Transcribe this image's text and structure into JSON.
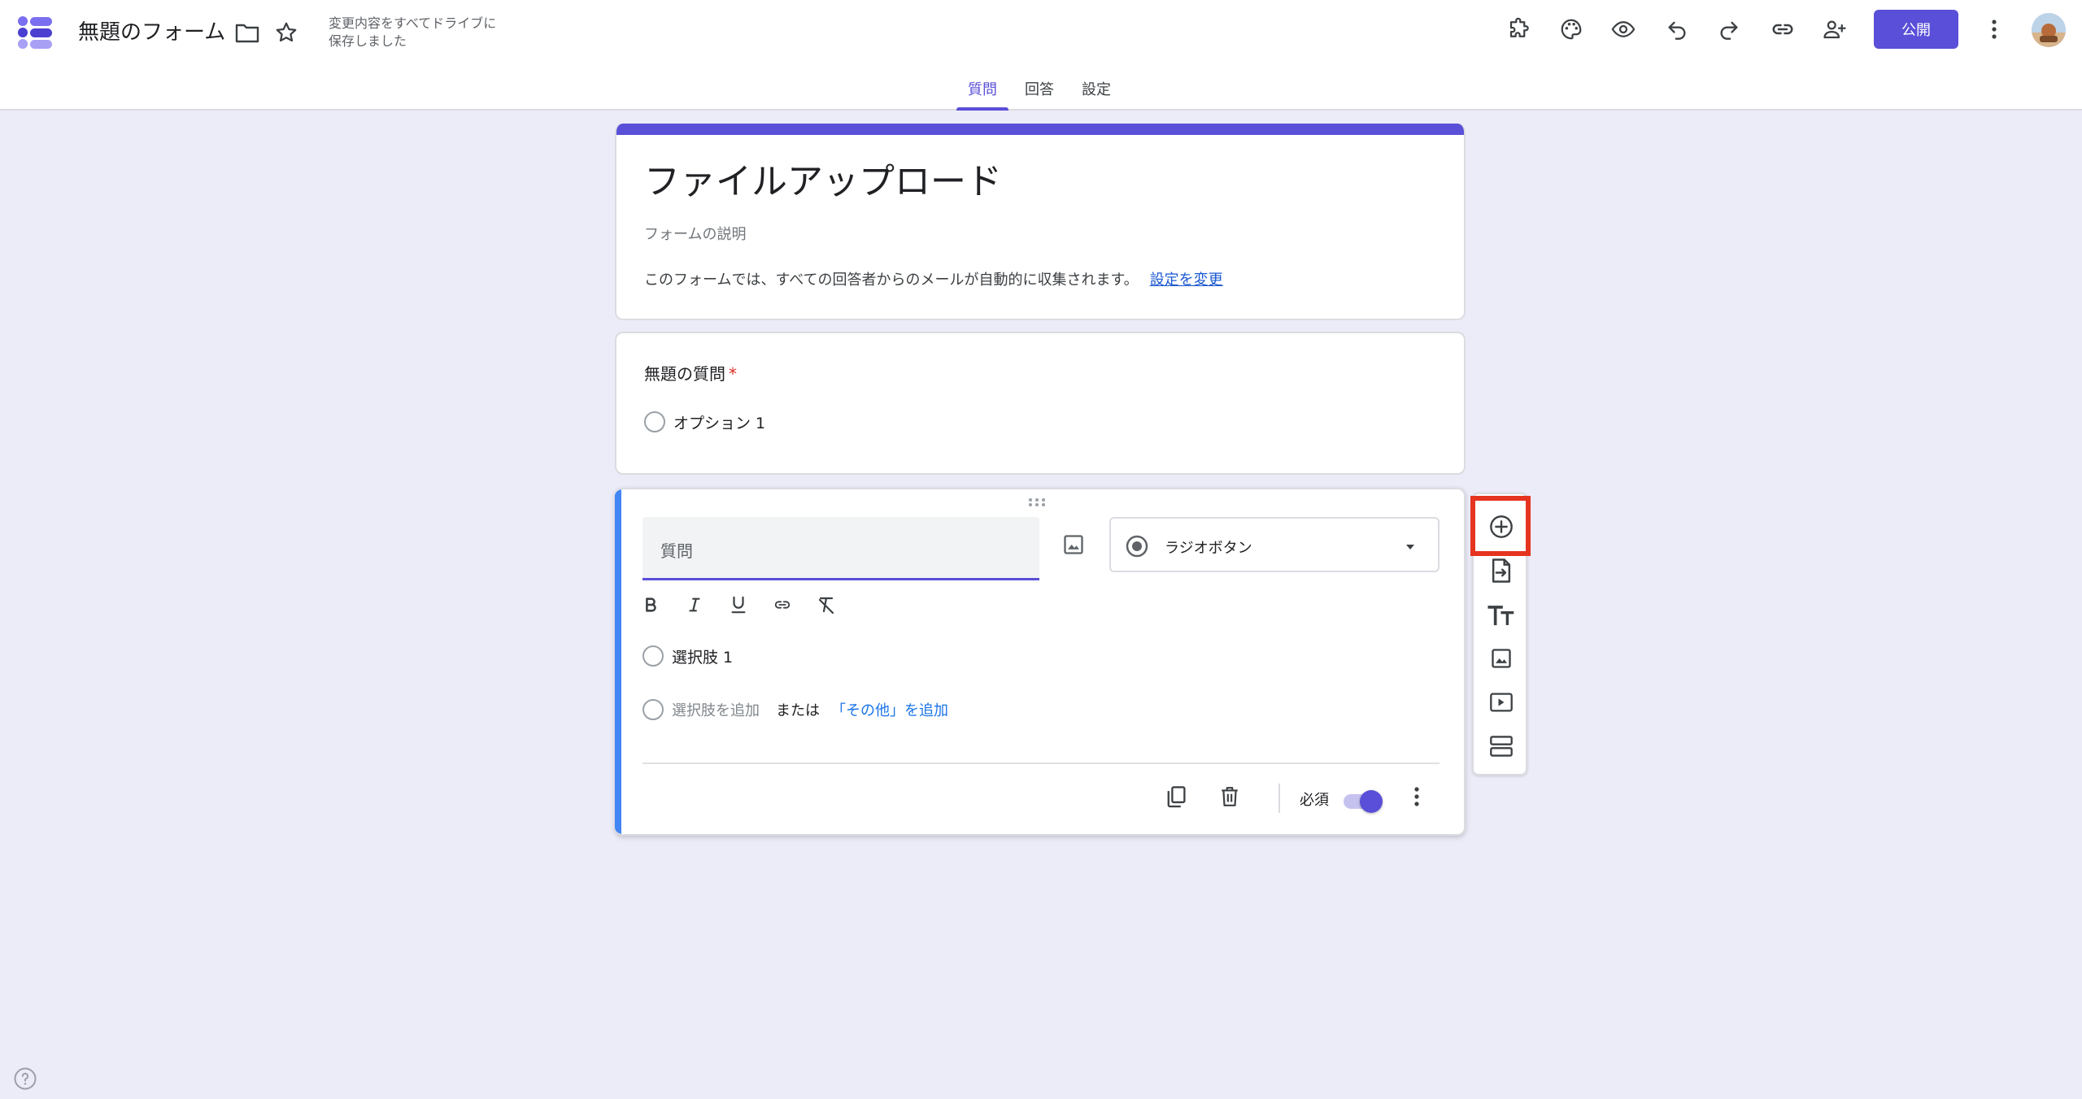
{
  "header": {
    "title": "無題のフォーム",
    "save_status_line1": "変更内容をすべてドライブに",
    "save_status_line2": "保存しました",
    "publish_label": "公開"
  },
  "tabs": [
    {
      "label": "質問",
      "active": true
    },
    {
      "label": "回答",
      "active": false
    },
    {
      "label": "設定",
      "active": false
    }
  ],
  "title_card": {
    "title": "ファイルアップロード",
    "description_placeholder": "フォームの説明",
    "email_note": "このフォームでは、すべての回答者からのメールが自動的に収集されます。",
    "change_settings_link": "設定を変更"
  },
  "question1": {
    "title": "無題の質問",
    "required_mark": "*",
    "option": "オプション 1"
  },
  "editing_question": {
    "placeholder": "質問",
    "type_label": "ラジオボタン",
    "option1": "選択肢 1",
    "add_option": "選択肢を追加",
    "or": "または",
    "add_other": "「その他」を追加",
    "required_label": "必須",
    "required_on": true
  },
  "toolbar": {
    "items": [
      "add-question-icon",
      "import-questions-icon",
      "add-title-icon",
      "add-image-icon",
      "add-video-icon",
      "add-section-icon"
    ]
  },
  "colors": {
    "accent": "#5a4fd8",
    "background": "#ecebf8",
    "highlight": "#e5341f",
    "question_bar": "#4285f4"
  }
}
